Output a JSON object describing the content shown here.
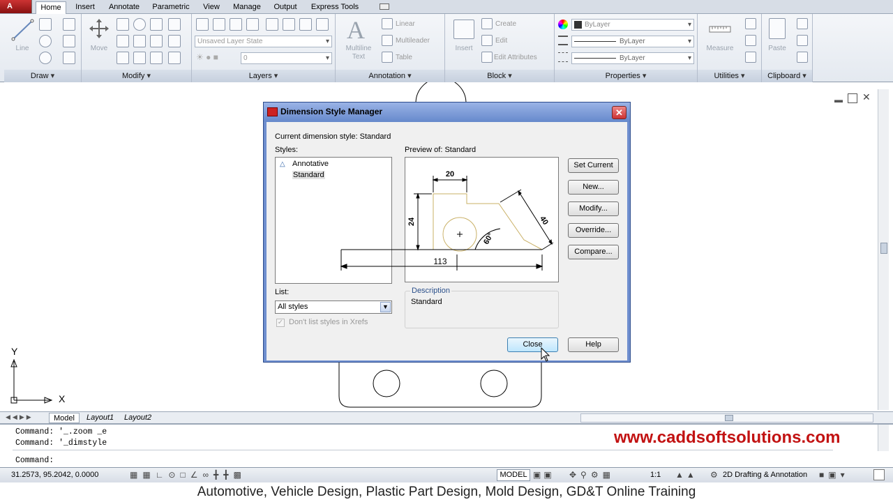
{
  "tabs": [
    "Home",
    "Insert",
    "Annotate",
    "Parametric",
    "View",
    "Manage",
    "Output",
    "Express Tools"
  ],
  "ribbon": {
    "panels": [
      "Draw",
      "Modify",
      "Layers",
      "Annotation",
      "Block",
      "Properties",
      "Utilities",
      "Clipboard"
    ],
    "draw": {
      "line": "Line"
    },
    "modify": {
      "move": "Move"
    },
    "layers": {
      "layer_state": "Unsaved Layer State",
      "layer_value": "0"
    },
    "annotation": {
      "multiline": "Multiline",
      "text": "Text",
      "linear": "Linear",
      "multileader": "Multileader",
      "table": "Table"
    },
    "block": {
      "insert": "Insert",
      "create": "Create",
      "edit": "Edit",
      "edit_attributes": "Edit Attributes"
    },
    "properties": {
      "color": "ByLayer",
      "linetype": "ByLayer",
      "lineweight": "ByLayer"
    },
    "utilities": {
      "measure": "Measure"
    },
    "clipboard": {
      "paste": "Paste"
    }
  },
  "dialog": {
    "title": "Dimension Style Manager",
    "current_style": "Current dimension style: Standard",
    "styles_label": "Styles:",
    "styles": [
      "Annotative",
      "Standard"
    ],
    "preview_label": "Preview of: Standard",
    "preview_dims": {
      "top": "20",
      "left": "24",
      "angle": "60°",
      "diag": "40",
      "bottom": "113"
    },
    "buttons": {
      "set_current": "Set Current",
      "new": "New...",
      "modify": "Modify...",
      "override": "Override...",
      "compare": "Compare...",
      "close": "Close",
      "help": "Help"
    },
    "list_label": "List:",
    "list_value": "All styles",
    "xref_check": "Don't list styles in Xrefs",
    "description_label": "Description",
    "description_value": "Standard"
  },
  "ucs": {
    "y": "Y",
    "x": "X"
  },
  "layout_tabs": [
    "Model",
    "Layout1",
    "Layout2"
  ],
  "command": {
    "line1": "Command: '_.zoom _e",
    "line2": "Command: '_dimstyle",
    "prompt": "Command:"
  },
  "watermark": "www.caddsoftsolutions.com",
  "status": {
    "coords": "31.2573, 95.2042, 0.0000",
    "model": "MODEL",
    "scale": "1:1",
    "workspace": "2D Drafting & Annotation"
  },
  "caption": "Automotive, Vehicle Design, Plastic Part Design, Mold Design, GD&T Online Training"
}
